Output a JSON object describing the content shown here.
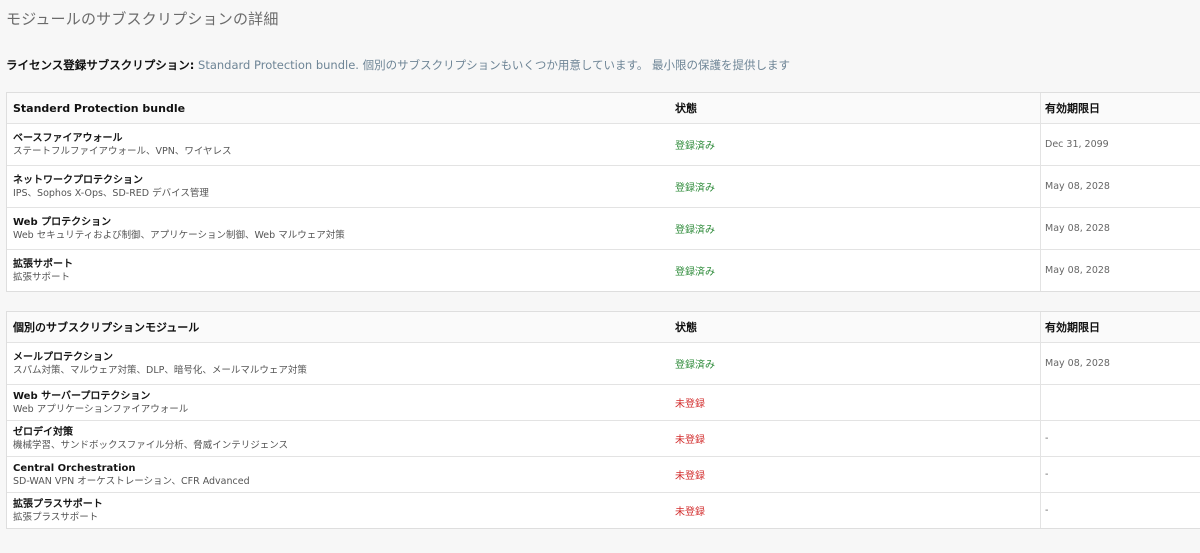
{
  "page": {
    "title": "モジュールのサブスクリプションの詳細"
  },
  "license": {
    "label": "ライセンス登録サブスクリプション:",
    "value": " Standard Protection bundle. 個別のサブスクリプションもいくつか用意しています。 最小限の保護を提供します"
  },
  "bundle_table": {
    "headers": {
      "module": "Standerd Protection bundle",
      "status": "状態",
      "expiry": "有効期限日"
    },
    "rows": [
      {
        "name": "ベースファイアウォール",
        "desc": "ステートフルファイアウォール、VPN、ワイヤレス",
        "status": "登録済み",
        "expiry": "Dec 31, 2099"
      },
      {
        "name": "ネットワークプロテクション",
        "desc": "IPS、Sophos X-Ops、SD-RED デバイス管理",
        "status": "登録済み",
        "expiry": "May 08, 2028"
      },
      {
        "name": "Web プロテクション",
        "desc": "Web セキュリティおよび制御、アプリケーション制御、Web マルウェア対策",
        "status": "登録済み",
        "expiry": "May 08, 2028"
      },
      {
        "name": "拡張サポート",
        "desc": "拡張サポート",
        "status": "登録済み",
        "expiry": "May 08, 2028"
      }
    ]
  },
  "module_table": {
    "headers": {
      "module": "個別のサブスクリプションモジュール",
      "status": "状態",
      "expiry": "有効期限日"
    },
    "rows": [
      {
        "name": "メールプロテクション",
        "desc": "スパム対策、マルウェア対策、DLP、暗号化、メールマルウェア対策",
        "status": "登録済み",
        "expiry": "May 08, 2028"
      },
      {
        "name": "Web サーバープロテクション",
        "desc": "Web アプリケーションファイアウォール",
        "status": "未登録",
        "expiry": ""
      },
      {
        "name": "ゼロデイ対策",
        "desc": "機械学習、サンドボックスファイル分析、脅威インテリジェンス",
        "status": "未登録",
        "expiry": "-"
      },
      {
        "name": "Central Orchestration",
        "desc": "SD-WAN VPN オーケストレーション、CFR Advanced",
        "status": "未登録",
        "expiry": "-"
      },
      {
        "name": "拡張プラスサポート",
        "desc": "拡張プラスサポート",
        "status": "未登録",
        "expiry": "-"
      }
    ]
  },
  "colors": {
    "subscribed": "#2e8b3a",
    "unsubscribed": "#d22b2b",
    "accent_text": "#6e8596"
  }
}
